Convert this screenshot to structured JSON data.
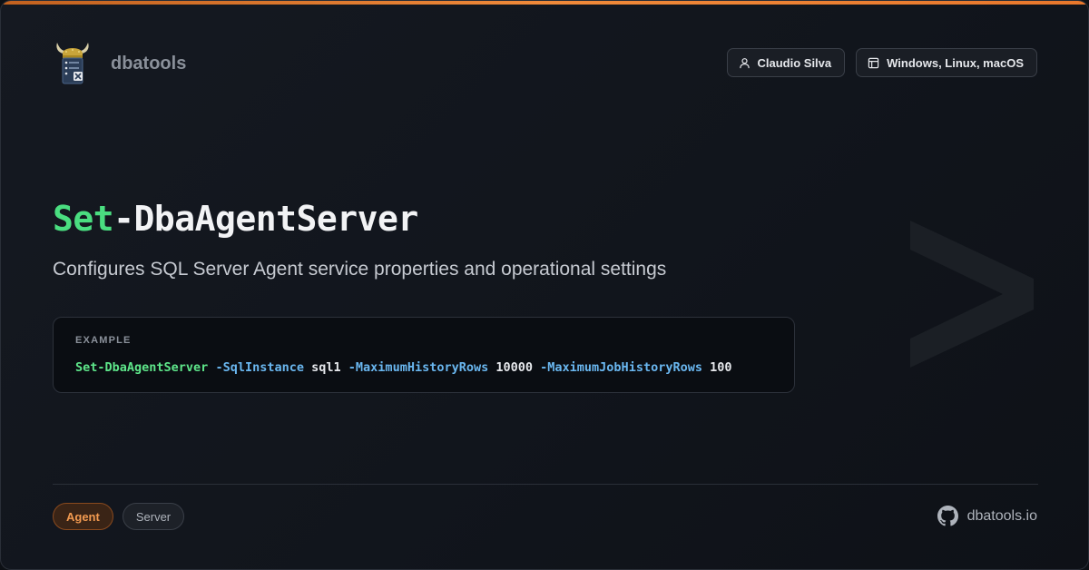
{
  "brand": {
    "name": "dbatools",
    "logo_icon": "dbatools-viking-logo-icon"
  },
  "header_pills": [
    {
      "label": "Claudio Silva",
      "icon": "user-icon"
    },
    {
      "label": "Windows, Linux, macOS",
      "icon": "layout-icon"
    }
  ],
  "title": {
    "verb": "Set",
    "rest": "-DbaAgentServer"
  },
  "subtitle": "Configures SQL Server Agent service properties and operational settings",
  "example": {
    "label": "EXAMPLE",
    "tokens": {
      "cmd": "Set-DbaAgentServer",
      "p1": "-SqlInstance",
      "v1": "sql1",
      "p2": "-MaximumHistoryRows",
      "v2": "10000",
      "p3": "-MaximumJobHistoryRows",
      "v3": "100"
    }
  },
  "tags": [
    {
      "label": "Agent"
    },
    {
      "label": "Server"
    }
  ],
  "site": {
    "label": "dbatools.io",
    "icon": "github-icon"
  },
  "colors": {
    "accent_orange": "#f08a3a",
    "verb_green": "#4ade80",
    "param_blue": "#6ab7f0",
    "background": "#11151c"
  }
}
